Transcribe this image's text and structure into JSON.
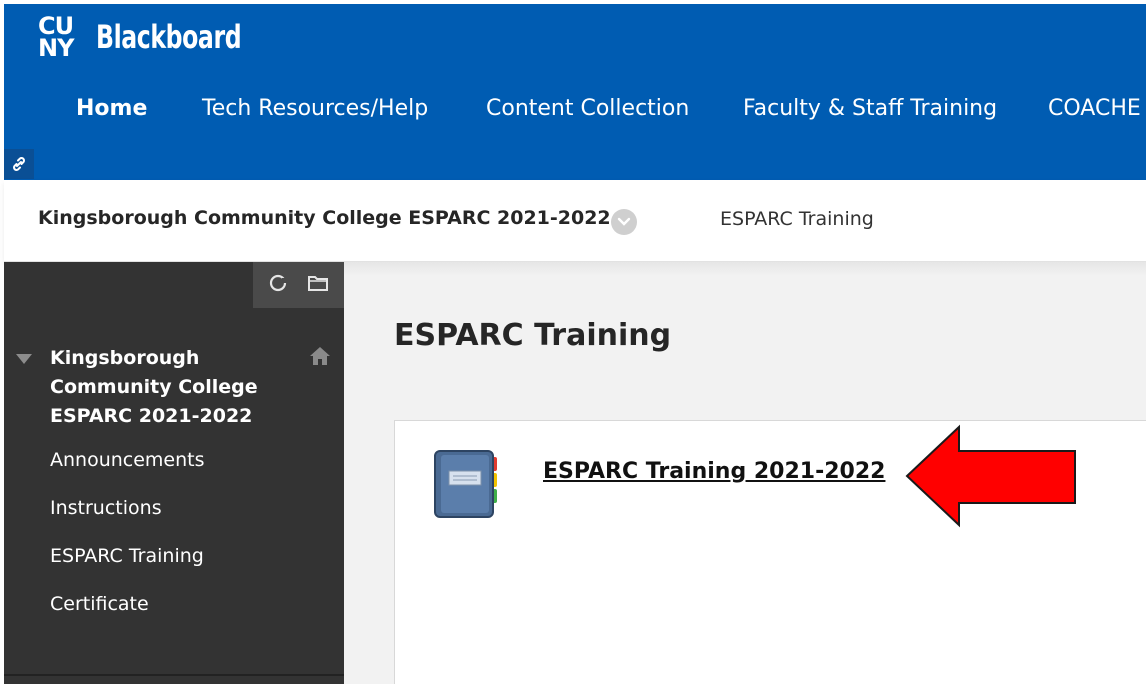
{
  "brand": {
    "logo_mark_top": "CU",
    "logo_mark_bottom": "NY",
    "name": "Blackboard"
  },
  "nav": {
    "items": [
      {
        "label": "Home",
        "active": true
      },
      {
        "label": "Tech Resources/Help"
      },
      {
        "label": "Content Collection"
      },
      {
        "label": "Faculty & Staff Training"
      },
      {
        "label": "COACHE"
      }
    ]
  },
  "breadcrumb": {
    "course": "Kingsborough Community College ESPARC 2021-2022",
    "current": "ESPARC Training"
  },
  "sidebar": {
    "course_title": "Kingsborough Community College ESPARC 2021-2022",
    "items": [
      {
        "label": "Announcements"
      },
      {
        "label": "Instructions"
      },
      {
        "label": "ESPARC Training"
      },
      {
        "label": "Certificate"
      }
    ]
  },
  "main": {
    "page_title": "ESPARC Training",
    "content_item": {
      "label": "ESPARC Training 2021-2022",
      "icon": "notebook-icon"
    }
  },
  "colors": {
    "header_blue": "#005cb2",
    "sidebar_bg": "#333333",
    "arrow_red": "#ff0000"
  }
}
